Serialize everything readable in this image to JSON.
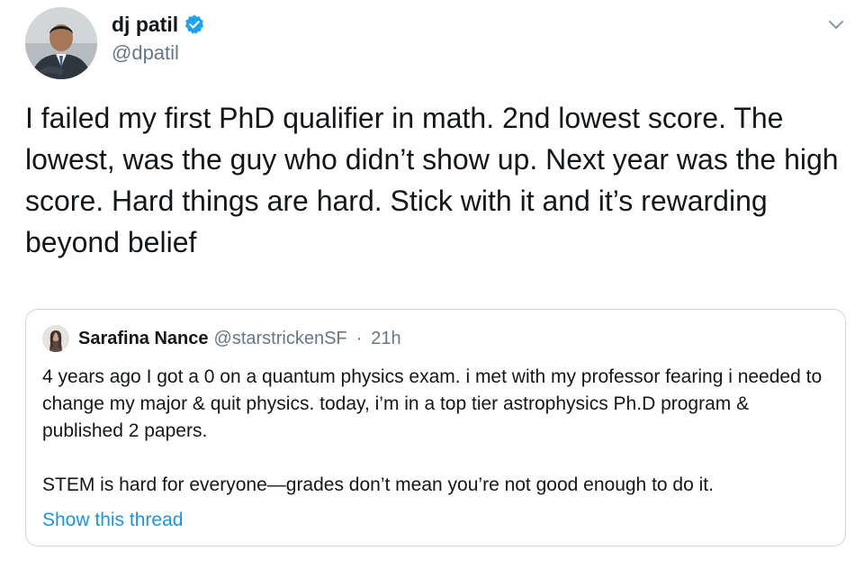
{
  "author": {
    "display_name": "dj patil",
    "handle": "@dpatil",
    "verified": true,
    "avatar_icon": "person-in-suit-avatar"
  },
  "tweet": {
    "text": "I failed my first PhD qualifier in math. 2nd lowest score. The lowest, was the guy who didn’t show up. Next year was the high score. Hard things are hard. Stick with it and it’s rewarding beyond belief"
  },
  "menu": {
    "icon": "chevron-down-icon"
  },
  "quoted_tweet": {
    "display_name": "Sarafina Nance",
    "handle": "@starstrickenSF",
    "separator": "·",
    "time": "21h",
    "paragraph_1": "4 years ago I got a 0 on a quantum physics exam. i met with my professor fearing i needed to change my major & quit physics. today, i’m in a top tier astrophysics Ph.D program & published 2 papers.",
    "paragraph_2": "STEM is hard for everyone—grades don’t mean you’re not good enough to do it.",
    "show_thread_label": "Show this thread"
  },
  "colors": {
    "text": "#14171a",
    "secondary_text": "#657786",
    "link": "#1b95e0",
    "verified_badge": "#1da1f2",
    "border": "#ccd6dd"
  }
}
